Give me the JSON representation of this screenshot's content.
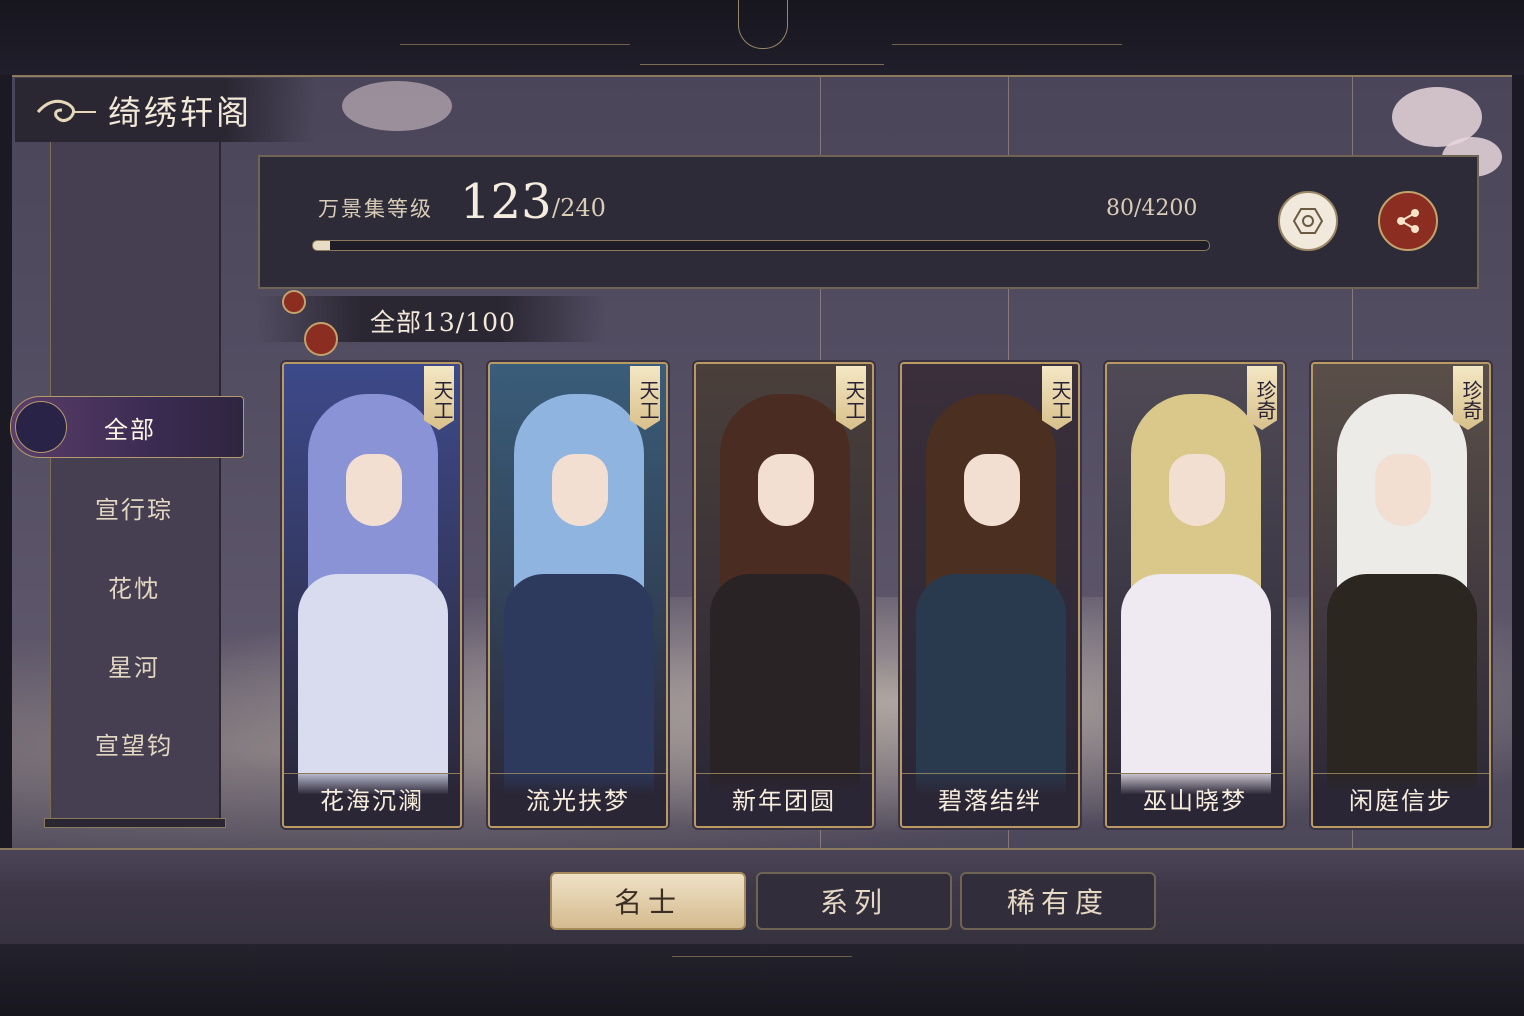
{
  "header": {
    "title": "绮绣轩阁"
  },
  "sidebar": {
    "items": [
      {
        "label": "全部",
        "active": true
      },
      {
        "label": "宣行琮",
        "active": false
      },
      {
        "label": "花忱",
        "active": false
      },
      {
        "label": "星河",
        "active": false
      },
      {
        "label": "宣望钧",
        "active": false
      }
    ]
  },
  "level": {
    "label": "万景集等级",
    "current": "123",
    "max": "/240",
    "exp": "80/4200",
    "progress": 0.019
  },
  "actions": {
    "grid_icon": "gallery-icon",
    "share_icon": "share-icon"
  },
  "collection": {
    "label": "全部13/100"
  },
  "cards": [
    {
      "name": "花海沉澜",
      "rarity": "天工",
      "hair": "#8a93d6",
      "robe": "#d9dbef"
    },
    {
      "name": "流光扶梦",
      "rarity": "天工",
      "hair": "#8fb4e0",
      "robe": "#2d3a5e"
    },
    {
      "name": "新年团圆",
      "rarity": "天工",
      "hair": "#4a2c22",
      "robe": "#2a2326"
    },
    {
      "name": "碧落结绊",
      "rarity": "天工",
      "hair": "#4b3022",
      "robe": "#2a3a4e"
    },
    {
      "name": "巫山晓梦",
      "rarity": "珍奇",
      "hair": "#d9c88a",
      "robe": "#efeaf2"
    },
    {
      "name": "闲庭信步",
      "rarity": "珍奇",
      "hair": "#ecebe8",
      "robe": "#2c2621"
    }
  ],
  "tabs": [
    {
      "label": "名士",
      "active": true
    },
    {
      "label": "系列",
      "active": false
    },
    {
      "label": "稀有度",
      "active": false
    }
  ],
  "colors": {
    "accent": "#b89a62",
    "panel": "#4b4559",
    "active_tab": "#e6d3b0"
  }
}
